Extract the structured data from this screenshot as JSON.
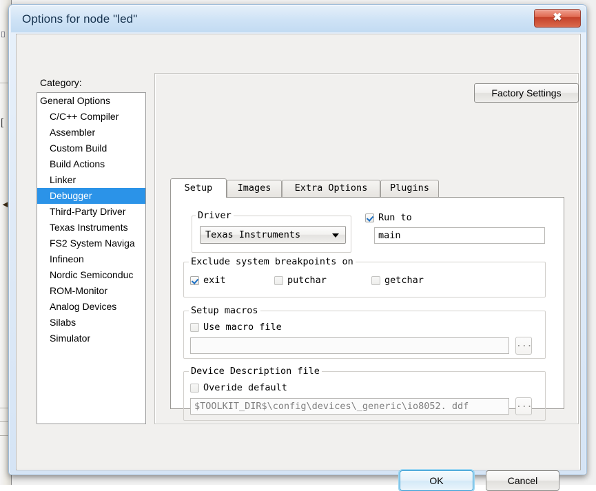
{
  "window": {
    "title": "Options for node \"led\"",
    "close_icon": "close-x-icon",
    "close_label": "✖"
  },
  "category": {
    "label": "Category:",
    "items": [
      {
        "label": "General Options",
        "indent": false,
        "selected": false
      },
      {
        "label": "C/C++ Compiler",
        "indent": true,
        "selected": false
      },
      {
        "label": "Assembler",
        "indent": true,
        "selected": false
      },
      {
        "label": "Custom Build",
        "indent": true,
        "selected": false
      },
      {
        "label": "Build Actions",
        "indent": true,
        "selected": false
      },
      {
        "label": "Linker",
        "indent": true,
        "selected": false
      },
      {
        "label": "Debugger",
        "indent": true,
        "selected": true
      },
      {
        "label": "Third-Party Driver",
        "indent": true,
        "selected": false
      },
      {
        "label": "Texas Instruments",
        "indent": true,
        "selected": false
      },
      {
        "label": "FS2 System Naviga",
        "indent": true,
        "selected": false
      },
      {
        "label": "Infineon",
        "indent": true,
        "selected": false
      },
      {
        "label": "Nordic Semiconduc",
        "indent": true,
        "selected": false
      },
      {
        "label": "ROM-Monitor",
        "indent": true,
        "selected": false
      },
      {
        "label": "Analog Devices",
        "indent": true,
        "selected": false
      },
      {
        "label": "Silabs",
        "indent": true,
        "selected": false
      },
      {
        "label": "Simulator",
        "indent": true,
        "selected": false
      }
    ]
  },
  "panel": {
    "factory_settings_label": "Factory Settings",
    "tabs": [
      {
        "label": "Setup",
        "active": true
      },
      {
        "label": "Images",
        "active": false
      },
      {
        "label": "Extra Options",
        "active": false
      },
      {
        "label": "Plugins",
        "active": false
      }
    ]
  },
  "setup": {
    "driver": {
      "group_label": "Driver",
      "selected": "Texas Instruments"
    },
    "run_to": {
      "label": "Run to",
      "checked": true,
      "value": "main"
    },
    "exclude_breakpoints": {
      "group_label": "Exclude system breakpoints on",
      "options": [
        {
          "label": "exit",
          "checked": true
        },
        {
          "label": "putchar",
          "checked": false
        },
        {
          "label": "getchar",
          "checked": false
        }
      ]
    },
    "setup_macros": {
      "group_label": "Setup macros",
      "use_macro_label": "Use macro file",
      "use_macro_checked": false,
      "path_value": "",
      "browse_label": "..."
    },
    "device_description": {
      "group_label": "Device Description file",
      "override_label": "Overide default",
      "override_checked": false,
      "path_value": "$TOOLKIT_DIR$\\config\\devices\\_generic\\io8052. ddf",
      "browse_label": "..."
    }
  },
  "footer": {
    "ok_label": "OK",
    "cancel_label": "Cancel"
  },
  "colors": {
    "selection_blue": "#2b93e8",
    "title_blue": "#cfe3f6",
    "close_red": "#c5412a",
    "focus_glow": "#9fd7f2"
  }
}
